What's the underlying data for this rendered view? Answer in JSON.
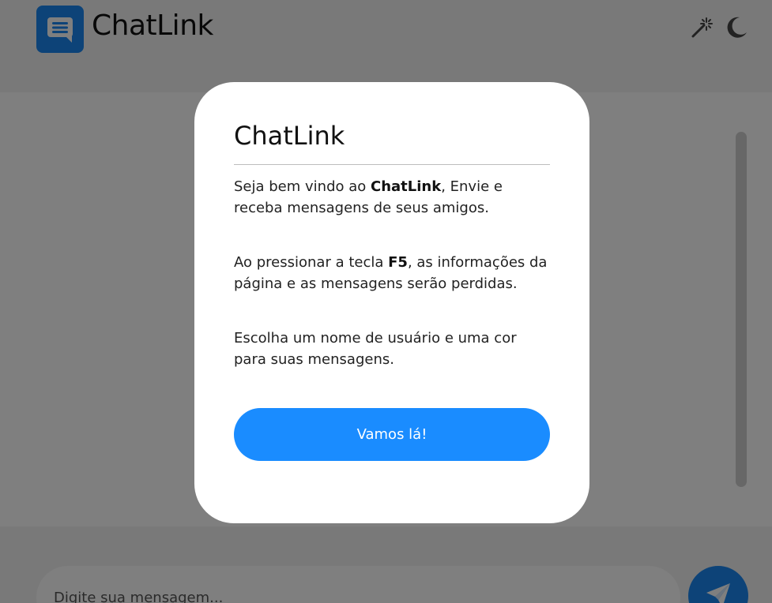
{
  "header": {
    "app_title": "ChatLink",
    "icons": [
      "chat-logo-icon",
      "magic-wand-icon",
      "moon-icon"
    ]
  },
  "footer": {
    "message_placeholder": "Digite sua mensagem...",
    "send_icon": "paper-plane-icon"
  },
  "modal": {
    "title": "ChatLink",
    "p1_pre": "Seja bem vindo ao ",
    "p1_bold": "ChatLink",
    "p1_post": ", Envie e receba mensagens de seus amigos.",
    "p2_pre": "Ao pressionar a tecla ",
    "p2_bold": "F5",
    "p2_post": ", as informações da página e as mensagens serão perdidas.",
    "p3": "Escolha um nome de usuário e uma cor para suas mensagens.",
    "button_label": "Vamos lá!"
  },
  "colors": {
    "accent": "#1a87f0",
    "button": "#1a8cff",
    "overlay": "rgba(0,0,0,0.5)"
  }
}
